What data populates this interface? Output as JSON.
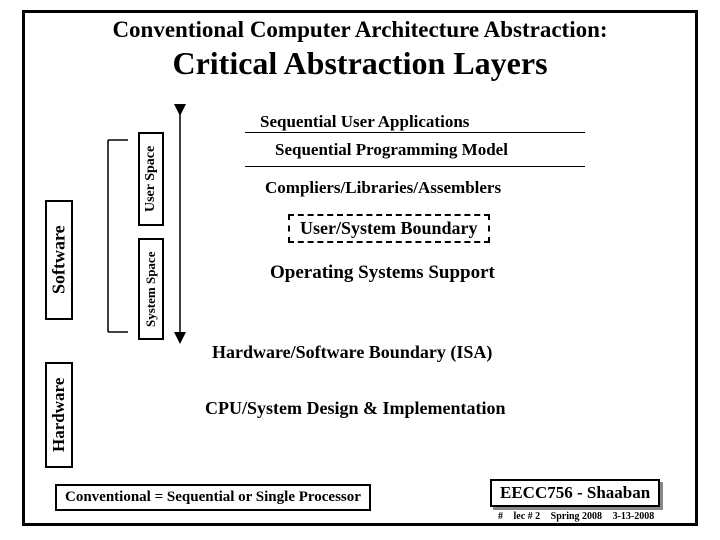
{
  "header": {
    "line1": "Conventional Computer Architecture Abstraction:",
    "line2": "Critical Abstraction Layers"
  },
  "layers": {
    "seq_apps": "Sequential User Applications",
    "seq_prog": "Sequential Programming Model",
    "compilers": "Compliers/Libraries/Assemblers",
    "us_boundary": "User/System Boundary",
    "os_support": "Operating Systems Support",
    "hw_sw_boundary": "Hardware/Software Boundary (ISA)",
    "cpu_design": "CPU/System Design & Implementation"
  },
  "side_labels": {
    "software": "Software",
    "hardware": "Hardware",
    "user_space": "User Space",
    "system_space": "System Space"
  },
  "footer": {
    "conventional": "Conventional = Sequential or Single Processor",
    "course": "EECC756 - Shaaban",
    "hash": "#",
    "lec": "lec # 2",
    "term": "Spring 2008",
    "date": "3-13-2008"
  }
}
